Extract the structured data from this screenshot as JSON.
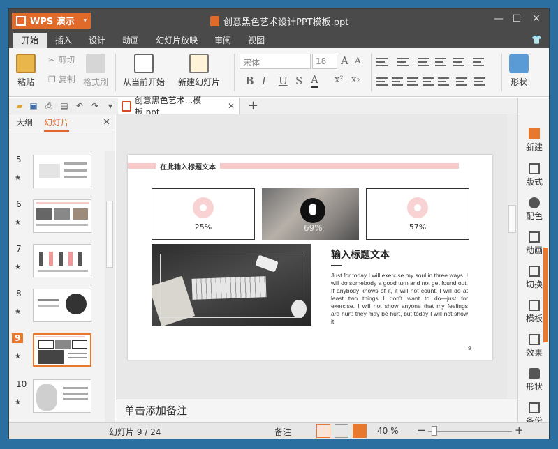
{
  "app": {
    "name": "WPS 演示",
    "title": "创意黑色艺术设计PPT模板.ppt"
  },
  "menu": [
    "开始",
    "插入",
    "设计",
    "动画",
    "幻灯片放映",
    "审阅",
    "视图"
  ],
  "ribbon": {
    "paste": "粘贴",
    "cut": "剪切",
    "copy": "复制",
    "format_painter": "格式刷",
    "play_from_current": "从当前开始",
    "new_slide": "新建幻灯片",
    "font_name": "宋体",
    "font_size": "18",
    "shapes": "形状"
  },
  "doc_tab": {
    "label": "创意黑色艺术...模板.ppt"
  },
  "left_panel": {
    "tabs": [
      "大纲",
      "幻灯片"
    ],
    "active_tab": "幻灯片",
    "slides": [
      {
        "num": "5"
      },
      {
        "num": "6"
      },
      {
        "num": "7"
      },
      {
        "num": "8"
      },
      {
        "num": "9",
        "selected": true
      },
      {
        "num": "10"
      }
    ]
  },
  "slide": {
    "title": "在此输入标题文本",
    "stats": [
      "25%",
      "69%",
      "57%"
    ],
    "heading": "输入标题文本",
    "body": "Just for today I will exercise my soul in three ways. I will do somebody a good turn and not get found out. If anybody knows of it, it will not count. I will do at least two things I don’t want to do—just for exercise. I will not show anyone that my feelings are hurt: they may be hurt, but today I will not show it.",
    "page_number": "9"
  },
  "notes": {
    "placeholder": "单击添加备注"
  },
  "right_panel": [
    "新建",
    "版式",
    "配色",
    "动画",
    "切换",
    "模板",
    "效果",
    "形状",
    "备份"
  ],
  "status": {
    "slide_count": "幻灯片 9 / 24",
    "notes": "备注",
    "zoom": "40 %"
  },
  "colors": {
    "accent": "#e06a2a",
    "titlebar": "#4a4a4a",
    "pink": "#f7c9c9"
  }
}
